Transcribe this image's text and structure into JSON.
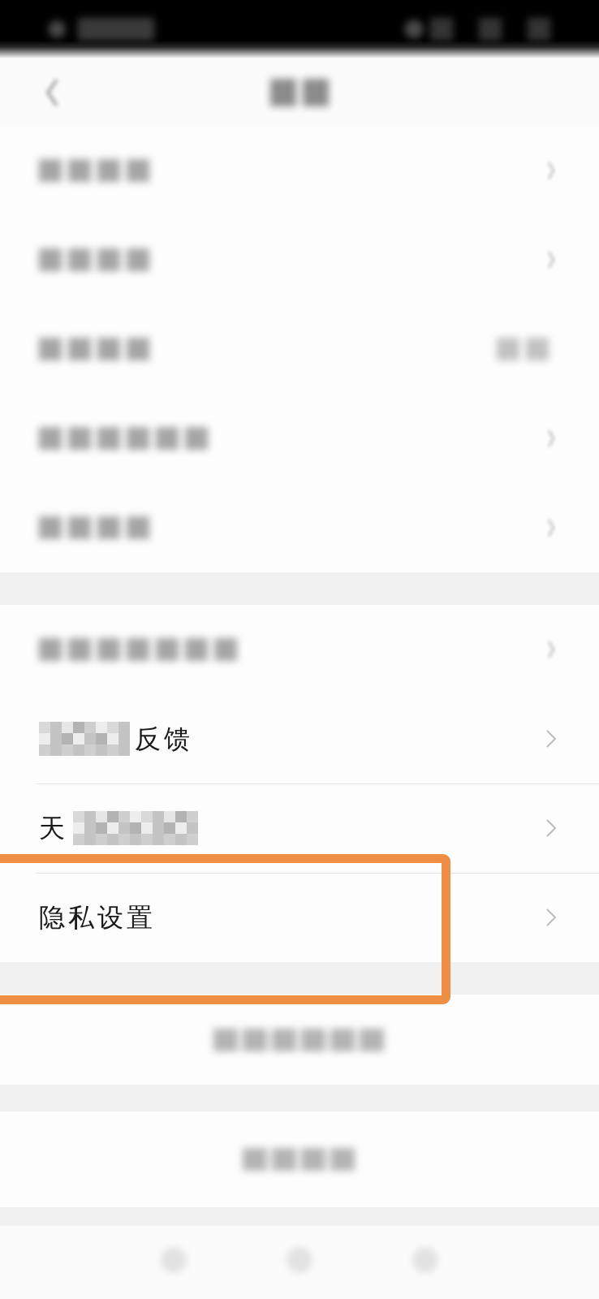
{
  "groups": [
    {
      "rows": [
        {
          "kind": "blurred",
          "accessory": {
            "kind": "chevron"
          },
          "highlighted": false
        },
        {
          "kind": "blurred",
          "accessory": {
            "kind": "chevron"
          },
          "highlighted": false
        },
        {
          "kind": "blurred",
          "accessory": {
            "kind": "value"
          },
          "highlighted": false
        },
        {
          "kind": "blurred",
          "accessory": {
            "kind": "chevron"
          },
          "highlighted": false
        },
        {
          "kind": "blurred",
          "accessory": {
            "kind": "chevron"
          },
          "highlighted": false
        }
      ]
    },
    {
      "rows": [
        {
          "kind": "blurred",
          "accessory": {
            "kind": "chevron"
          },
          "highlighted": false
        },
        {
          "kind": "masked_start",
          "label": "反馈",
          "accessory": {
            "kind": "chevron"
          },
          "highlighted": false
        },
        {
          "kind": "masked_end",
          "label": "天",
          "accessory": {
            "kind": "chevron"
          },
          "highlighted": false
        },
        {
          "kind": "plain",
          "label": "隐私设置",
          "accessory": {
            "kind": "chevron"
          },
          "highlighted": true
        }
      ]
    }
  ],
  "buttons": [
    {
      "kind": "blurred"
    },
    {
      "kind": "blurred"
    }
  ]
}
